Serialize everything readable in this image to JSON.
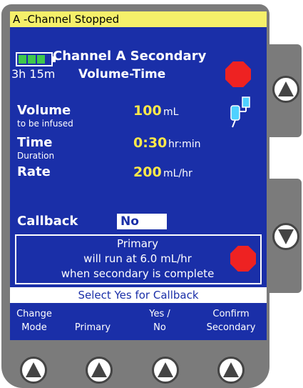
{
  "status": {
    "text": "A -Channel Stopped"
  },
  "header": {
    "channel_title": "Channel A Secondary",
    "battery_time": "3h 15m",
    "mode": "Volume-Time"
  },
  "fields": {
    "volume_label": "Volume",
    "volume_sublabel": "to be infused",
    "volume_value": "100",
    "volume_unit": "mL",
    "time_label": "Time",
    "time_sublabel": "Duration",
    "time_value": "0:30",
    "time_unit": "hr:min",
    "rate_label": "Rate",
    "rate_value": "200",
    "rate_unit": "mL/hr"
  },
  "callback": {
    "label": "Callback",
    "value": "No"
  },
  "message": {
    "line1": "Primary",
    "line2": "will run at 6.0 mL/hr",
    "line3": "when secondary is complete"
  },
  "prompt": "Select Yes for Callback",
  "softkeys": [
    {
      "line1": "Change",
      "line2": "Mode"
    },
    {
      "line1": "",
      "line2": "Primary"
    },
    {
      "line1": "Yes /",
      "line2": "No"
    },
    {
      "line1": "Confirm",
      "line2": "Secondary"
    }
  ],
  "colors": {
    "screen": "#1a2fa8",
    "status_bar": "#f5f06a",
    "value_text": "#ffe94a",
    "stop_sign": "#ee2222",
    "battery": "#3ec94a"
  },
  "icons": [
    "battery-icon",
    "stop-icon",
    "iv-bag-icon",
    "up-arrow-icon",
    "down-arrow-icon"
  ]
}
